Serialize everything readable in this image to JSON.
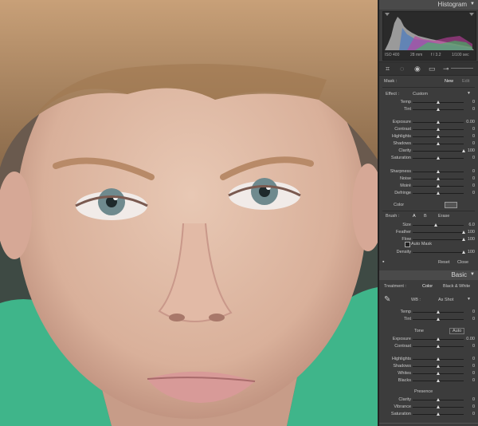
{
  "colors": {
    "panel_bg": "#3c3c3c",
    "header_bg": "#4a4a4a",
    "text": "#c8c8c8",
    "accent": "#e0e0e0"
  },
  "histogram": {
    "title": "Histogram",
    "iso": "ISO 400",
    "focal": "28 mm",
    "aperture": "f / 3.2",
    "shutter": "1/100 sec"
  },
  "toolstrip": {
    "icons": [
      "crop-overlay-icon",
      "spot-removal-icon",
      "red-eye-icon",
      "graduated-filter-icon",
      "adjustment-brush-icon"
    ]
  },
  "mask": {
    "label": "Mask :",
    "new_label": "New",
    "edit_label": "Edit"
  },
  "effect": {
    "label": "Effect :",
    "preset": "Custom",
    "sliders": [
      {
        "name": "Temp",
        "value": "0",
        "pos": 0.5
      },
      {
        "name": "Tint",
        "value": "0",
        "pos": 0.5
      },
      {
        "name": "Exposure",
        "value": "0.00",
        "pos": 0.5
      },
      {
        "name": "Contrast",
        "value": "0",
        "pos": 0.5
      },
      {
        "name": "Highlights",
        "value": "0",
        "pos": 0.5
      },
      {
        "name": "Shadows",
        "value": "0",
        "pos": 0.5
      },
      {
        "name": "Clarity",
        "value": "100",
        "pos": 1.0
      },
      {
        "name": "Saturation",
        "value": "0",
        "pos": 0.5
      },
      {
        "name": "Sharpness",
        "value": "0",
        "pos": 0.5
      },
      {
        "name": "Noise",
        "value": "0",
        "pos": 0.5
      },
      {
        "name": "Moiré",
        "value": "0",
        "pos": 0.5
      },
      {
        "name": "Defringe",
        "value": "0",
        "pos": 0.5
      }
    ],
    "color_label": "Color"
  },
  "brush": {
    "label": "Brush :",
    "a": "A",
    "b": "B",
    "erase": "Erase",
    "sliders": [
      {
        "name": "Size",
        "value": "6.0",
        "pos": 0.45
      },
      {
        "name": "Feather",
        "value": "100",
        "pos": 1.0
      },
      {
        "name": "Flow",
        "value": "100",
        "pos": 1.0
      }
    ],
    "auto_mask": "Auto Mask",
    "density": {
      "name": "Density",
      "value": "100",
      "pos": 1.0
    },
    "reset": "Reset",
    "close": "Close"
  },
  "basic": {
    "title": "Basic",
    "treatment_label": "Treatment :",
    "color": "Color",
    "bw": "Black & White",
    "wb_label": "WB :",
    "wb_value": "As Shot",
    "wb_sliders": [
      {
        "name": "Temp",
        "value": "0",
        "pos": 0.5
      },
      {
        "name": "Tint",
        "value": "0",
        "pos": 0.5
      }
    ],
    "tone_label": "Tone",
    "auto": "Auto",
    "tone_sliders": [
      {
        "name": "Exposure",
        "value": "0.00",
        "pos": 0.5
      },
      {
        "name": "Contrast",
        "value": "0",
        "pos": 0.5
      },
      {
        "name": "Highlights",
        "value": "0",
        "pos": 0.5
      },
      {
        "name": "Shadows",
        "value": "0",
        "pos": 0.5
      },
      {
        "name": "Whites",
        "value": "0",
        "pos": 0.5
      },
      {
        "name": "Blacks",
        "value": "0",
        "pos": 0.5
      }
    ],
    "presence_label": "Presence",
    "presence_sliders": [
      {
        "name": "Clarity",
        "value": "0",
        "pos": 0.5
      },
      {
        "name": "Vibrance",
        "value": "0",
        "pos": 0.5
      },
      {
        "name": "Saturation",
        "value": "0",
        "pos": 0.5
      }
    ]
  }
}
